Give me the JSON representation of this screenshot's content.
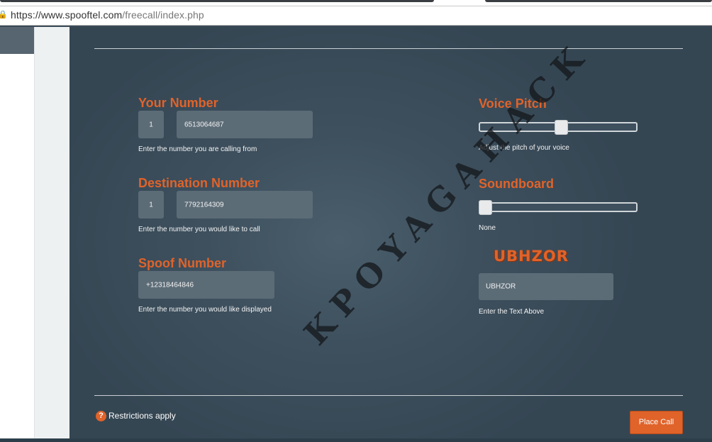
{
  "browser": {
    "url_host": "https://www.spooftel.com",
    "url_path": "/freecall/index.php"
  },
  "form": {
    "your_number": {
      "label": "Your Number",
      "country_code": "1",
      "number": "6513064687",
      "help": "Enter the number you are calling from"
    },
    "destination_number": {
      "label": "Destination Number",
      "country_code": "1",
      "number": "7792164309",
      "help": "Enter the number you would like to call"
    },
    "spoof_number": {
      "label": "Spoof Number",
      "number": "+12318464846",
      "help": "Enter the number you would like displayed"
    },
    "voice_pitch": {
      "label": "Voice Pitch",
      "value_fraction": 0.52,
      "help": "Adjust the pitch of your voice"
    },
    "soundboard": {
      "label": "Soundboard",
      "value_fraction": 0.0,
      "selected": "None"
    },
    "captcha": {
      "image_text": "UBHZOR",
      "input_value": "UBHZOR",
      "help": "Enter the Text Above"
    }
  },
  "footer": {
    "restrictions_label": "Restrictions apply",
    "place_call_label": "Place Call"
  },
  "watermark": "KPOYAGAHACK",
  "colors": {
    "accent": "#e0632a",
    "panel": "#3e505e",
    "field": "#5c6c77"
  }
}
